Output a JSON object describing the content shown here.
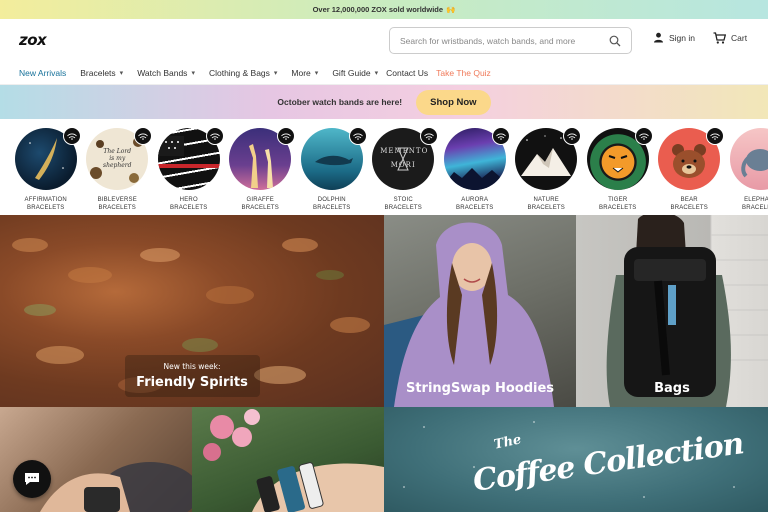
{
  "announcement": {
    "text": "Over 12,000,000 ZOX sold worldwide",
    "emoji": "🙌"
  },
  "header": {
    "logo": "zox",
    "search_placeholder": "Search for wristbands, watch bands, and more",
    "signin_label": "Sign in",
    "cart_label": "Cart"
  },
  "nav": {
    "items": [
      {
        "label": "New Arrivals",
        "has_dropdown": false
      },
      {
        "label": "Bracelets",
        "has_dropdown": true
      },
      {
        "label": "Watch Bands",
        "has_dropdown": true
      },
      {
        "label": "Clothing & Bags",
        "has_dropdown": true
      },
      {
        "label": "More",
        "has_dropdown": true
      },
      {
        "label": "Gift Guide",
        "has_dropdown": true
      },
      {
        "label": "Contact Us",
        "has_dropdown": false
      },
      {
        "label": "Take The Quiz",
        "has_dropdown": false
      }
    ]
  },
  "promo": {
    "text": "October watch bands are here!",
    "button_label": "Shop Now"
  },
  "categories": [
    {
      "line1": "AFFIRMATION",
      "line2": "BRACELETS"
    },
    {
      "line1": "BIBLEVERSE",
      "line2": "BRACELETS",
      "art_text": "The Lord is my shepherd"
    },
    {
      "line1": "HERO",
      "line2": "BRACELETS"
    },
    {
      "line1": "GIRAFFE",
      "line2": "BRACELETS"
    },
    {
      "line1": "DOLPHIN",
      "line2": "BRACELETS"
    },
    {
      "line1": "STOIC",
      "line2": "BRACELETS",
      "art_text": "MEMENTO MORI"
    },
    {
      "line1": "AURORA",
      "line2": "BRACELETS"
    },
    {
      "line1": "NATURE",
      "line2": "BRACELETS"
    },
    {
      "line1": "TIGER",
      "line2": "BRACELETS"
    },
    {
      "line1": "BEAR",
      "line2": "BRACELETS"
    },
    {
      "line1": "ELEPHANT",
      "line2": "BRACELETS"
    }
  ],
  "tiles": {
    "friendly": {
      "subtitle": "New this week:",
      "title": "Friendly Spirits"
    },
    "hoodies": {
      "title": "StringSwap Hoodies"
    },
    "bags": {
      "title": "Bags"
    },
    "coffee": {
      "line1": "The",
      "line2": "Coffee Collection"
    }
  },
  "colors": {
    "nav_active": "#16719a",
    "quiz": "#f07a5a",
    "shop_now_bg": "#fbd88a"
  },
  "icons": [
    "search-icon",
    "user-icon",
    "cart-icon",
    "chevron-down-icon",
    "nfc-badge-icon",
    "chat-icon"
  ]
}
